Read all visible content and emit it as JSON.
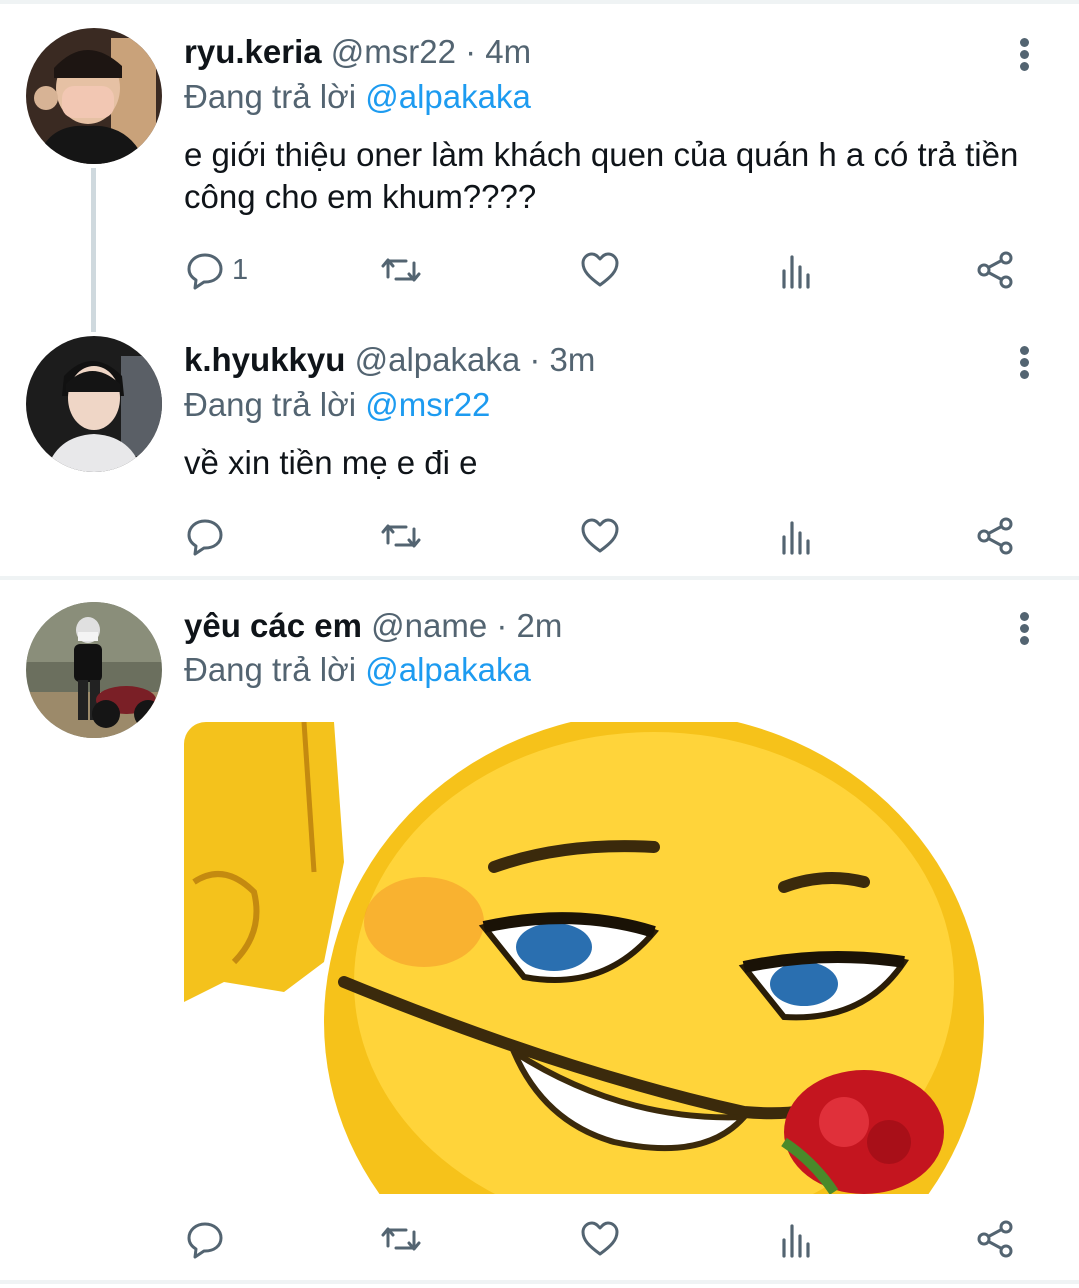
{
  "tweets": [
    {
      "display_name": "ryu.keria",
      "handle": "@msr22",
      "separator": "·",
      "time": "4m",
      "reply_prefix": "Đang trả lời",
      "reply_to": "@alpakaka",
      "text": "e giới thiệu oner làm khách quen của quán h a có trả tiền công cho em khum????",
      "reply_count": "1",
      "icons": [
        "reply-icon",
        "retweet-icon",
        "like-icon",
        "views-icon",
        "share-icon",
        "more-icon"
      ]
    },
    {
      "display_name": "k.hyukkyu",
      "handle": "@alpakaka",
      "separator": "·",
      "time": "3m",
      "reply_prefix": "Đang trả lời",
      "reply_to": "@msr22",
      "text": "về xin tiền mẹ e đi e",
      "reply_count": "",
      "icons": [
        "reply-icon",
        "retweet-icon",
        "like-icon",
        "views-icon",
        "share-icon",
        "more-icon"
      ]
    },
    {
      "display_name": "yêu các em",
      "handle": "@name",
      "separator": "·",
      "time": "2m",
      "reply_prefix": "Đang trả lời",
      "reply_to": "@alpakaka",
      "media": "smug-emoji-with-rose-image",
      "reply_count": "",
      "icons": [
        "reply-icon",
        "retweet-icon",
        "like-icon",
        "views-icon",
        "share-icon",
        "more-icon"
      ]
    }
  ],
  "colors": {
    "mention": "#1d9bf0",
    "secondary_text": "#536471",
    "primary_text": "#0f1419",
    "divider": "#eff3f4",
    "thread_line": "#cfd9de"
  }
}
